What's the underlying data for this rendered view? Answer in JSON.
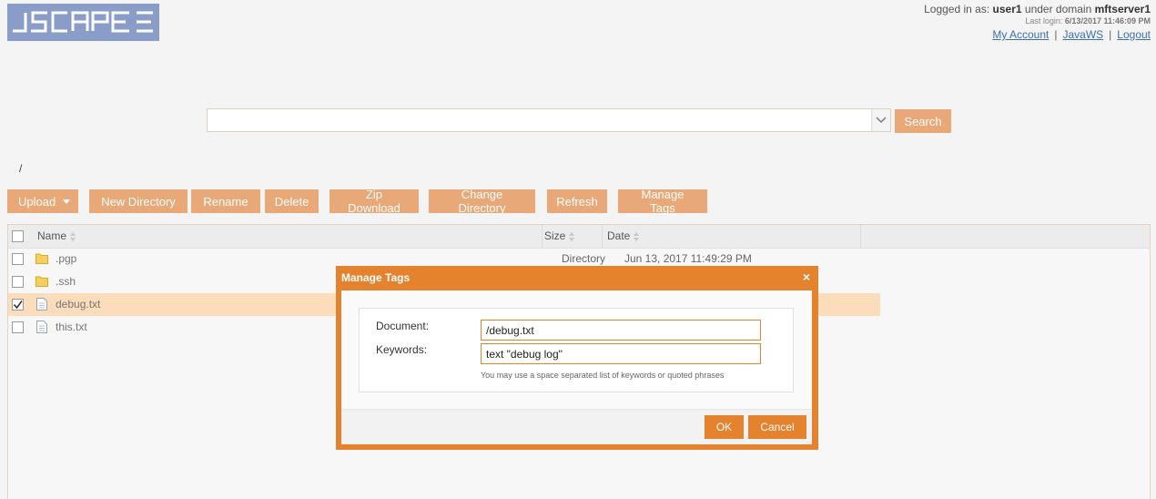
{
  "header": {
    "logo_text": "JSCAPE",
    "logged_in_prefix": "Logged in as:",
    "user": "user1",
    "domain_prefix": "under domain",
    "domain": "mftserver1",
    "last_login_label": "Last login:",
    "last_login_value": "6/13/2017 11:46:09 PM",
    "links": [
      "My Account",
      "JavaWS",
      "Logout"
    ],
    "link_separator": "|"
  },
  "search": {
    "value": "",
    "placeholder": "",
    "button_label": "Search"
  },
  "breadcrumb": "/",
  "toolbar": {
    "upload": "Upload",
    "new_directory": "New Directory",
    "rename": "Rename",
    "delete": "Delete",
    "zip_download": "Zip Download",
    "change_directory": "Change Directory",
    "refresh": "Refresh",
    "manage_tags": "Manage Tags"
  },
  "table": {
    "columns": {
      "name": "Name",
      "size": "Size",
      "date": "Date"
    },
    "rows": [
      {
        "name": ".pgp",
        "icon": "folder-icon",
        "size": "Directory",
        "date": "Jun 13, 2017 11:49:29 PM",
        "checked": false
      },
      {
        "name": ".ssh",
        "icon": "folder-icon",
        "size": "",
        "date": "",
        "checked": false
      },
      {
        "name": "debug.txt",
        "icon": "file-icon",
        "size": "",
        "date": "",
        "checked": true
      },
      {
        "name": "this.txt",
        "icon": "file-icon",
        "size": "",
        "date": "",
        "checked": false
      }
    ]
  },
  "dialog": {
    "title": "Manage Tags",
    "close_glyph": "×",
    "document_label": "Document:",
    "document_value": "/debug.txt",
    "keywords_label": "Keywords:",
    "keywords_value": "text \"debug log\"",
    "hint": "You may use a space separated list of keywords or quoted phrases",
    "ok": "OK",
    "cancel": "Cancel"
  },
  "colors": {
    "accent": "#e4822e",
    "button": "#e8a878",
    "selected_row": "#fbdcbb",
    "logo": "#8a9dc8",
    "link": "#3b6fb6"
  }
}
